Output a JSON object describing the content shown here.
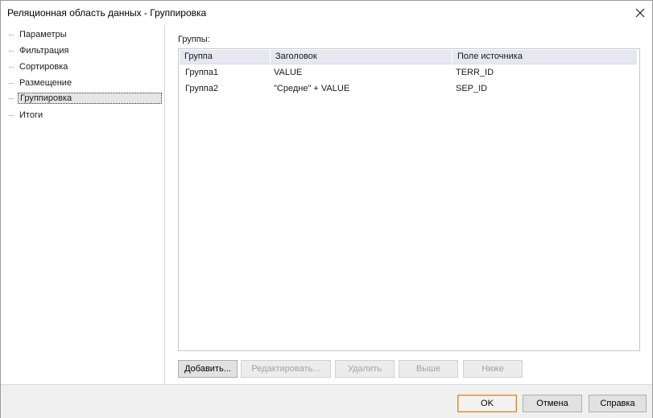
{
  "window": {
    "title": "Реляционная область данных - Группировка"
  },
  "nav": {
    "items": [
      {
        "label": "Параметры",
        "selected": false
      },
      {
        "label": "Фильтрация",
        "selected": false
      },
      {
        "label": "Сортировка",
        "selected": false
      },
      {
        "label": "Размещение",
        "selected": false
      },
      {
        "label": "Группировка",
        "selected": true
      },
      {
        "label": "Итоги",
        "selected": false
      }
    ]
  },
  "groups": {
    "label": "Группы:",
    "columns": [
      "Группа",
      "Заголовок",
      "Поле источника"
    ],
    "rows": [
      [
        "Группа1",
        "VALUE",
        "TERR_ID"
      ],
      [
        "Группа2",
        "\"Средне\" + VALUE",
        "SEP_ID"
      ]
    ]
  },
  "actions": {
    "add": "Добавить...",
    "edit": "Редактировать...",
    "delete": "Удалить",
    "up": "Выше",
    "down": "Ниже"
  },
  "footer": {
    "ok": "OK",
    "cancel": "Отмена",
    "help": "Справка"
  }
}
